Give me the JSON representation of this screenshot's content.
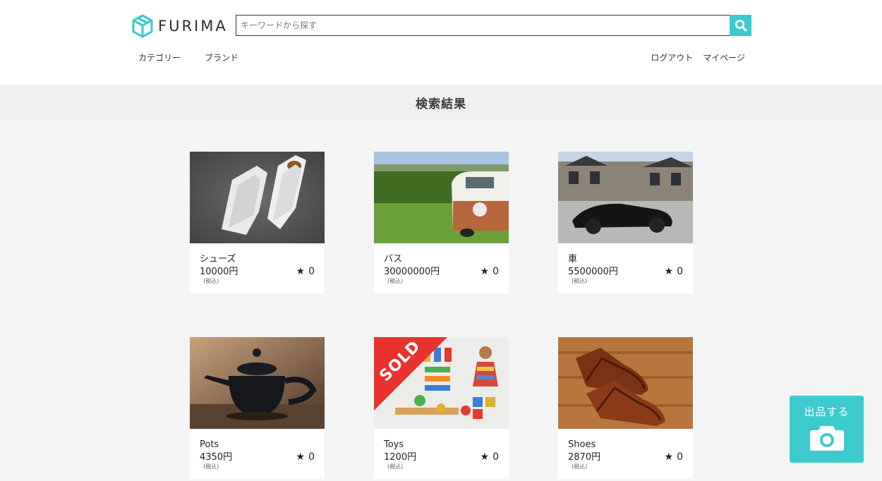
{
  "header": {
    "logo_text": "FURIMA",
    "search": {
      "placeholder": "キーワードから探す",
      "value": ""
    },
    "nav_left": [
      "カテゴリー",
      "ブランド"
    ],
    "nav_right": [
      "ログアウト",
      "マイページ"
    ]
  },
  "results": {
    "title": "検索結果"
  },
  "items": [
    {
      "name": "シューズ",
      "price": "10000円",
      "tax": "(税込)",
      "likes": "0",
      "sold": false
    },
    {
      "name": "バス",
      "price": "30000000円",
      "tax": "(税込)",
      "likes": "0",
      "sold": false
    },
    {
      "name": "車",
      "price": "5500000円",
      "tax": "(税込)",
      "likes": "0",
      "sold": false
    },
    {
      "name": "Pots",
      "price": "4350円",
      "tax": "(税込)",
      "likes": "0",
      "sold": false
    },
    {
      "name": "Toys",
      "price": "1200円",
      "tax": "(税込)",
      "likes": "0",
      "sold": true,
      "sold_label": "SOLD"
    },
    {
      "name": "Shoes",
      "price": "2870円",
      "tax": "(税込)",
      "likes": "0",
      "sold": false
    }
  ],
  "sell_button": {
    "label": "出品する"
  },
  "colors": {
    "accent": "#3ccace",
    "sold": "#e8332e",
    "band": "#efefef"
  },
  "icons": {
    "star": "★",
    "search": "search-icon",
    "camera": "camera-icon",
    "logo": "cube-logo-icon"
  }
}
